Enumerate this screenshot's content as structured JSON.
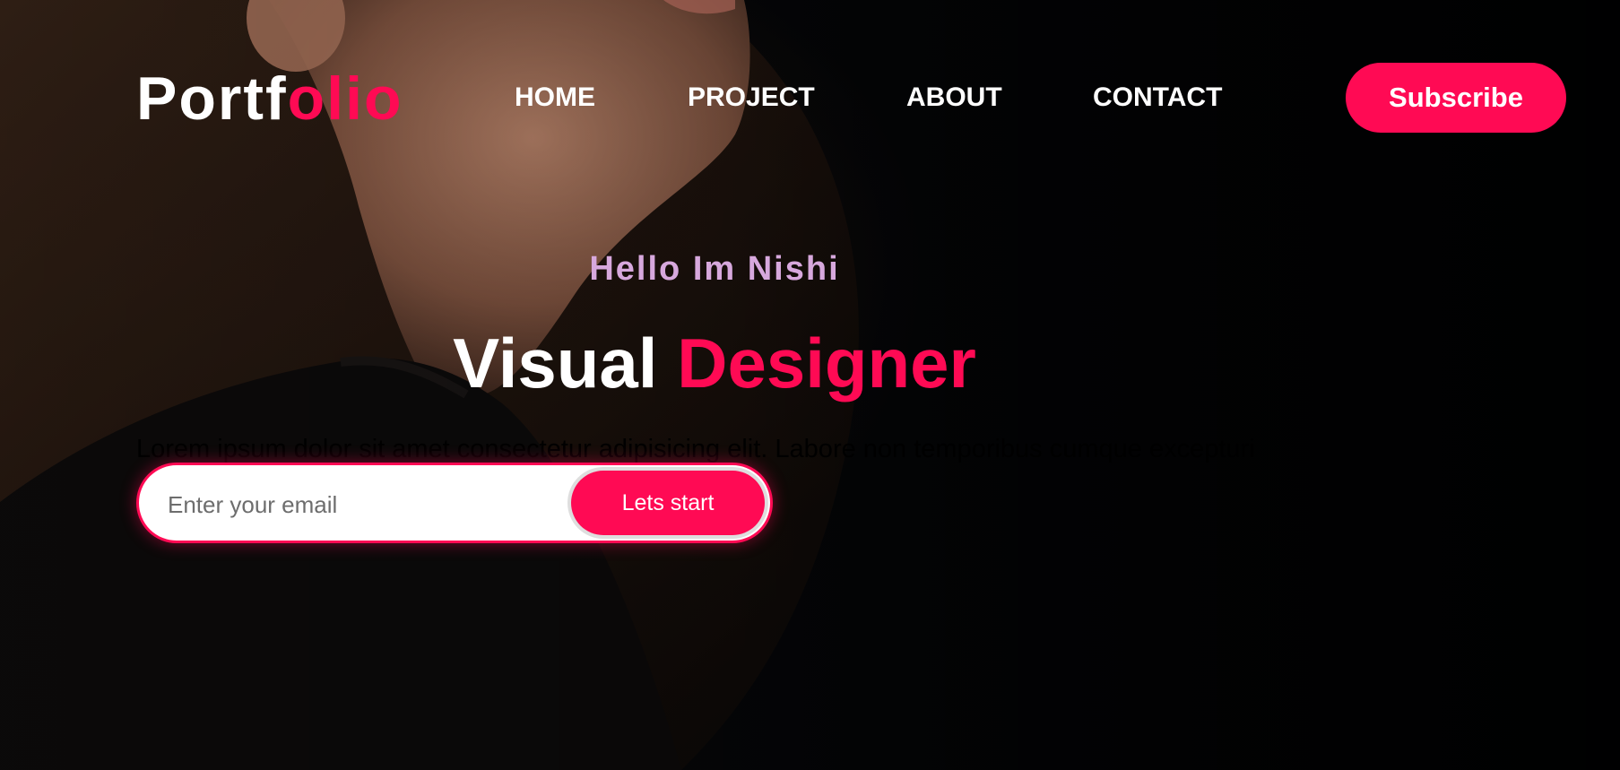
{
  "logo": {
    "part1": "Portf",
    "part2": "olio"
  },
  "nav": {
    "items": [
      {
        "label": "HOME"
      },
      {
        "label": "PROJECT"
      },
      {
        "label": "ABOUT"
      },
      {
        "label": "CONTACT"
      }
    ],
    "subscribe_label": "Subscribe"
  },
  "hero": {
    "greeting": "Hello Im Nishi",
    "title_white": "Visual",
    "title_accent": "Designer",
    "paragraph": "Lorem ipsum dolor sit amet consectetur adipisicing elit. Labore non temporibus cumque excepturi",
    "email_placeholder": "Enter your email",
    "cta_label": "Lets start"
  },
  "colors": {
    "accent": "#ff0a54",
    "greeting": "#d7a8dd",
    "background": "#03060a"
  },
  "icons": {
    "background": "portrait-photo"
  }
}
